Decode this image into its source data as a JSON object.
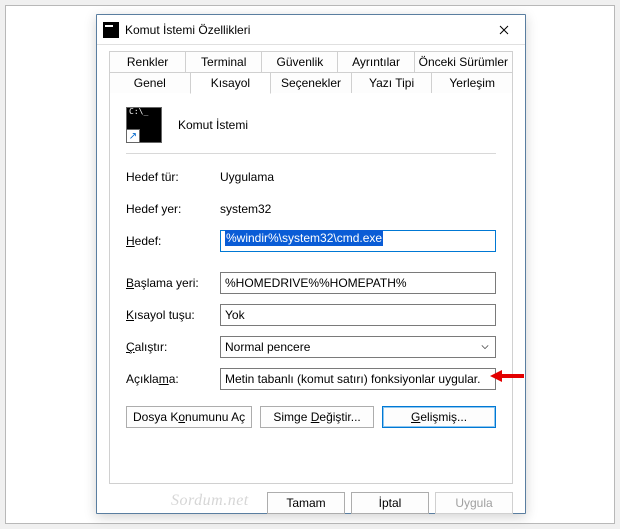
{
  "title": "Komut İstemi Özellikleri",
  "tabs_row1": [
    "Renkler",
    "Terminal",
    "Güvenlik",
    "Ayrıntılar",
    "Önceki Sürümler"
  ],
  "tabs_row2": [
    "Genel",
    "Kısayol",
    "Seçenekler",
    "Yazı Tipi",
    "Yerleşim"
  ],
  "active_tab": "Kısayol",
  "shortcut_name": "Komut İstemi",
  "fields": {
    "target_type_label": "Hedef tür:",
    "target_type_value": "Uygulama",
    "target_loc_label": "Hedef yer:",
    "target_loc_value": "system32",
    "target_label": "Hedef:",
    "target_value": "%windir%\\system32\\cmd.exe",
    "start_in_label": "Başlama yeri:",
    "start_in_value": "%HOMEDRIVE%%HOMEPATH%",
    "shortcut_key_label": "Kısayol tuşu:",
    "shortcut_key_value": "Yok",
    "run_label": "Çalıştır:",
    "run_value": "Normal pencere",
    "comment_label": "Açıklama:",
    "comment_value": "Metin tabanlı (komut satırı) fonksiyonlar uygular."
  },
  "buttons": {
    "open_loc": "Dosya Konumunu Aç",
    "change_icon": "Simge Değiştir...",
    "advanced": "Gelişmiş..."
  },
  "bottom": {
    "ok": "Tamam",
    "cancel": "İptal",
    "apply": "Uygula"
  },
  "watermark": "Sordum.net"
}
